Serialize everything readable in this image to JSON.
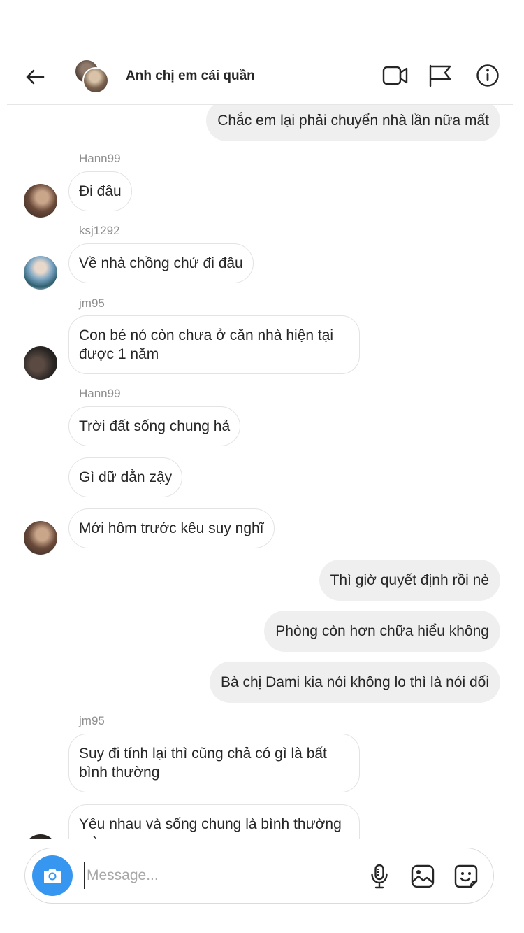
{
  "header": {
    "title": "Anh chị em cái quần",
    "back_icon": "back-arrow-icon",
    "video_icon": "video-call-icon",
    "flag_icon": "flag-icon",
    "info_icon": "info-icon"
  },
  "messages": [
    {
      "text": "Chắc em lại phải chuyển nhà lần nữa mất"
    },
    {
      "sender": "Hann99",
      "text": "Đi đâu"
    },
    {
      "sender": "ksj1292",
      "text": "Về nhà chồng chứ đi đâu"
    },
    {
      "sender": "jm95",
      "text": "Con bé nó còn chưa ở căn nhà hiện tại được 1 năm"
    },
    {
      "sender": "Hann99",
      "text": "Trời đất sống chung hả"
    },
    {
      "text": "Gì dữ dằn zậy"
    },
    {
      "text": "Mới hôm trước kêu suy nghĩ"
    },
    {
      "text": "Thì giờ quyết định rồi nè"
    },
    {
      "text": "Phòng còn hơn chữa hiểu không"
    },
    {
      "text": "Bà chị Dami kia nói không lo thì là nói dối"
    },
    {
      "sender": "jm95",
      "text": "Suy đi tính lại thì cũng chả có gì là bất bình thường"
    },
    {
      "text": "Yêu nhau và sống chung là bình thường mà"
    }
  ],
  "composer": {
    "placeholder": "Message...",
    "value": "",
    "camera_icon": "camera-icon",
    "mic_icon": "microphone-icon",
    "gallery_icon": "image-icon",
    "sticker_icon": "sticker-icon"
  },
  "colors": {
    "accent": "#3797f0",
    "outgoing_bubble": "#efefef",
    "incoming_border": "#e3e3e3",
    "username_gray": "#8e8e8e"
  }
}
